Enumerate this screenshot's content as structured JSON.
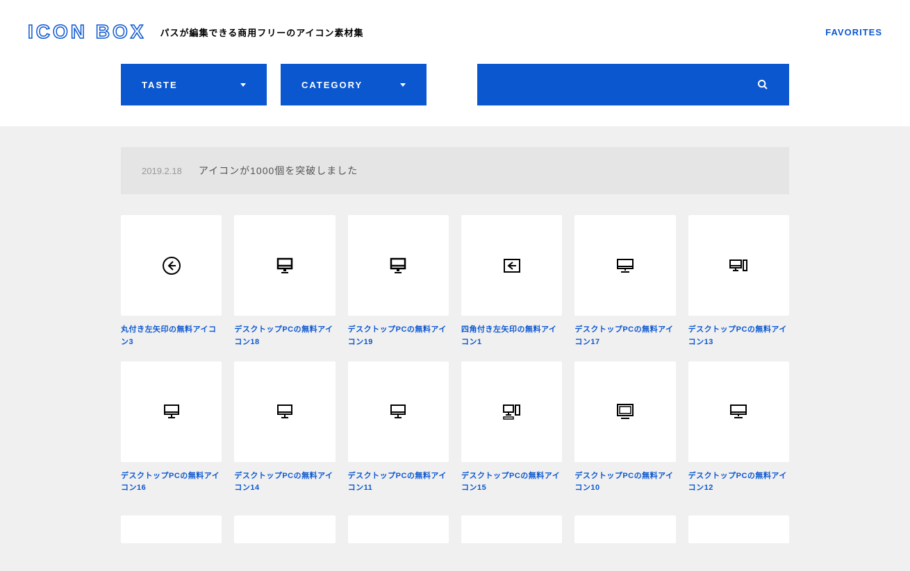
{
  "header": {
    "logo": "ICON BOX",
    "tagline": "パスが編集できる商用フリーのアイコン素材集",
    "favorites": "FAVORITES"
  },
  "filters": {
    "taste": "TASTE",
    "category": "CATEGORY"
  },
  "news": {
    "date": "2019.2.18",
    "text": "アイコンが1000個を突破しました"
  },
  "icons": [
    {
      "label": "丸付き左矢印の無料アイコン3",
      "type": "circle-arrow-left"
    },
    {
      "label": "デスクトップPCの無料アイコン18",
      "type": "monitor-stand-thick"
    },
    {
      "label": "デスクトップPCの無料アイコン19",
      "type": "monitor-stand-thick"
    },
    {
      "label": "四角付き左矢印の無料アイコン1",
      "type": "square-arrow-left"
    },
    {
      "label": "デスクトップPCの無料アイコン17",
      "type": "monitor-stand-wide"
    },
    {
      "label": "デスクトップPCの無料アイコン13",
      "type": "monitor-tower"
    },
    {
      "label": "デスクトップPCの無料アイコン16",
      "type": "monitor-stand"
    },
    {
      "label": "デスクトップPCの無料アイコン14",
      "type": "monitor-stand"
    },
    {
      "label": "デスクトップPCの無料アイコン11",
      "type": "monitor-stand"
    },
    {
      "label": "デスクトップPCの無料アイコン15",
      "type": "monitor-tower-keyboard"
    },
    {
      "label": "デスクトップPCの無料アイコン10",
      "type": "monitor-flat"
    },
    {
      "label": "デスクトップPCの無料アイコン12",
      "type": "monitor-stand-wide"
    }
  ],
  "icon_svgs": {
    "circle-arrow-left": "<circle cx='16' cy='16' r='12' stroke='#000' stroke-width='2' fill='none'/><path d='M18 10 L12 16 L18 22' stroke='#000' stroke-width='2' fill='none'/><line x1='12' y1='16' x2='22' y2='16' stroke='#000' stroke-width='2'/>",
    "square-arrow-left": "<rect x='5' y='7' width='22' height='18' stroke='#000' stroke-width='2' fill='none'/><path d='M17 11 L11 16 L17 21' stroke='#000' stroke-width='2' fill='none'/><line x1='11' y1='16' x2='22' y2='16' stroke='#000' stroke-width='2'/>",
    "monitor-stand-thick": "<rect x='6' y='6' width='20' height='14' stroke='#000' stroke-width='2.5' fill='none'/><line x1='6' y1='16' x2='26' y2='16' stroke='#000' stroke-width='2.5'/><rect x='14' y='20' width='4' height='4' fill='#000'/><line x1='11' y1='26' x2='21' y2='26' stroke='#000' stroke-width='2'/>",
    "monitor-stand": "<rect x='6' y='7' width='20' height='13' stroke='#000' stroke-width='2' fill='none'/><line x1='6' y1='17' x2='26' y2='17' stroke='#000' stroke-width='2'/><line x1='16' y1='20' x2='16' y2='24' stroke='#000' stroke-width='2'/><line x1='11' y1='25' x2='21' y2='25' stroke='#000' stroke-width='2'/>",
    "monitor-stand-wide": "<rect x='5' y='7' width='22' height='13' stroke='#000' stroke-width='2' fill='none'/><line x1='5' y1='17' x2='27' y2='17' stroke='#000' stroke-width='2'/><line x1='16' y1='20' x2='16' y2='23' stroke='#000' stroke-width='2'/><line x1='10' y1='25' x2='22' y2='25' stroke='#000' stroke-width='2'/>",
    "monitor-tower": "<rect x='4' y='8' width='16' height='11' stroke='#000' stroke-width='2' fill='none'/><line x1='4' y1='16' x2='20' y2='16' stroke='#000' stroke-width='2'/><line x1='12' y1='19' x2='12' y2='22' stroke='#000' stroke-width='2'/><line x1='8' y1='23' x2='16' y2='23' stroke='#000' stroke-width='2'/><rect x='23' y='8' width='5' height='15' stroke='#000' stroke-width='2' fill='none'/>",
    "monitor-tower-keyboard": "<rect x='4' y='7' width='14' height='10' stroke='#000' stroke-width='2' fill='none'/><line x1='11' y1='17' x2='11' y2='20' stroke='#000' stroke-width='2'/><line x1='7' y1='21' x2='15' y2='21' stroke='#000' stroke-width='2'/><rect x='21' y='7' width='6' height='14' stroke='#000' stroke-width='2' fill='none'/><rect x='4' y='24' width='14' height='3' stroke='#000' stroke-width='1.5' fill='none'/>",
    "monitor-flat": "<rect x='5' y='6' width='22' height='16' stroke='#000' stroke-width='2' fill='none'/><rect x='8' y='9' width='16' height='10' stroke='#000' stroke-width='1.5' fill='none'/><line x1='10' y1='26' x2='22' y2='26' stroke='#000' stroke-width='2'/>"
  }
}
